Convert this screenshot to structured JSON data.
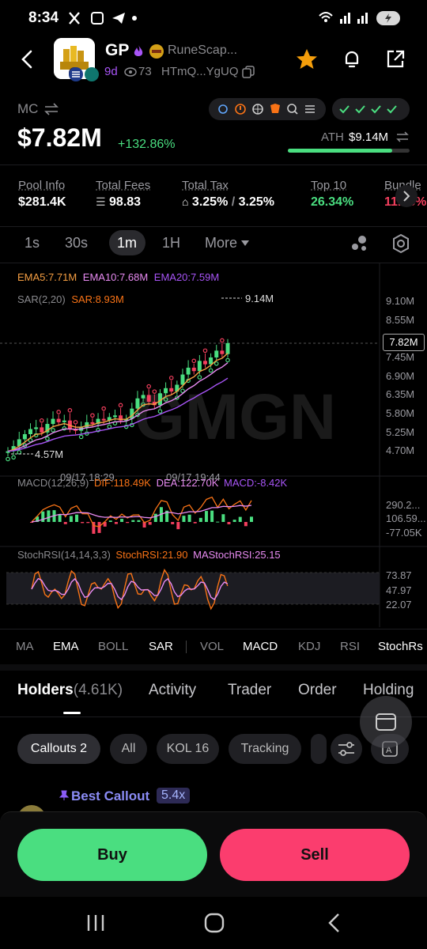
{
  "status_bar": {
    "time": "8:34"
  },
  "token": {
    "symbol": "GP",
    "name": "RuneScap...",
    "age": "9d",
    "views": "73",
    "address": "HTmQ...YgUQ"
  },
  "mc": {
    "label": "MC",
    "value": "$7.82M",
    "change": "+132.86%",
    "ath_label": "ATH",
    "ath_value": "$9.14M",
    "ath_progress": 0.855
  },
  "pool": [
    {
      "label": "Pool Info",
      "value": "$281.4K"
    },
    {
      "label": "Total Fees",
      "value": "98.83"
    },
    {
      "label": "Total Tax",
      "value": "3.25%",
      "value2": "3.25%"
    },
    {
      "label": "Top 10",
      "value": "26.34%"
    },
    {
      "label": "Bundle",
      "value": "11.38%"
    }
  ],
  "timeframes": [
    "1s",
    "30s",
    "1m",
    "1H",
    "More"
  ],
  "timeframe_selected": "1m",
  "chart": {
    "ema_legend": [
      "EMA5:7.71M",
      "EMA10:7.68M",
      "EMA20:7.59M"
    ],
    "sar_legend": [
      "SAR(2,20)",
      "SAR:8.93M"
    ],
    "price_high_label": "9.14M",
    "price_low_label": "4.57M",
    "current_price": "7.82M",
    "y_ticks": [
      "9.10M",
      "8.55M",
      "7.45M",
      "6.90M",
      "6.35M",
      "5.80M",
      "5.25M",
      "4.70M"
    ],
    "x_ticks": [
      "09/17 18:29",
      "09/17 19:44"
    ],
    "watermark": "GMGN",
    "macd_legend": [
      "MACD(12,26,9)",
      "DIF:118.49K",
      "DEA:122.70K",
      "MACD:-8.42K"
    ],
    "macd_ticks": [
      "290.2...",
      "106.59...",
      "-77.05K"
    ],
    "stoch_legend": [
      "StochRSI(14,14,3,3)",
      "StochRSI:21.90",
      "MAStochRSI:25.15"
    ],
    "stoch_ticks": [
      "73.87",
      "47.97",
      "22.07"
    ]
  },
  "chart_data": {
    "type": "candlestick",
    "x_ticks": [
      "09/17 18:29",
      "09/17 19:44"
    ],
    "price_range": [
      4.57,
      9.14
    ],
    "price_unit": "M",
    "current": 7.82,
    "ath": 9.14,
    "low": 4.57,
    "ema5": 7.71,
    "ema10": 7.68,
    "ema20": 7.59,
    "sar": 8.93,
    "price_series": [
      4.65,
      4.8,
      5.0,
      5.15,
      5.3,
      5.35,
      5.2,
      5.45,
      5.6,
      5.5,
      5.55,
      5.3,
      5.25,
      5.35,
      5.5,
      5.45,
      5.6,
      5.55,
      5.65,
      5.7,
      5.55,
      5.6,
      5.9,
      6.2,
      6.3,
      6.1,
      6.0,
      6.35,
      6.5,
      6.4,
      6.6,
      6.9,
      7.1,
      7.0,
      7.3,
      7.2,
      7.4,
      7.6,
      7.5,
      7.82
    ],
    "macd": {
      "dif": 118.49,
      "dea": 122.7,
      "macd": -8.42,
      "unit": "K"
    },
    "stoch_rsi": {
      "value": 21.9,
      "ma": 25.15
    }
  },
  "indicators": [
    "MA",
    "EMA",
    "BOLL",
    "SAR",
    "VOL",
    "MACD",
    "KDJ",
    "RSI",
    "StochRs"
  ],
  "indicators_active": [
    "EMA",
    "SAR",
    "MACD",
    "StochRs"
  ],
  "tabs": {
    "holders": "Holders",
    "holders_count": "(4.61K)",
    "activity": "Activity",
    "trader": "Trader",
    "order": "Order",
    "holding": "Holding"
  },
  "chips": [
    "Callouts 2",
    "All",
    "KOL 16",
    "Tracking"
  ],
  "callout": {
    "label": "Best Callout",
    "multiplier": "5.4x"
  },
  "actions": {
    "buy": "Buy",
    "sell": "Sell"
  },
  "colors": {
    "buy": "#4ade80",
    "sell": "#fb3d6e",
    "up": "#4ade80",
    "down": "#f43f5e",
    "ema5": "#f59e42",
    "ema10": "#e88bf2",
    "ema20": "#a855f7",
    "sar": "#f97316"
  }
}
